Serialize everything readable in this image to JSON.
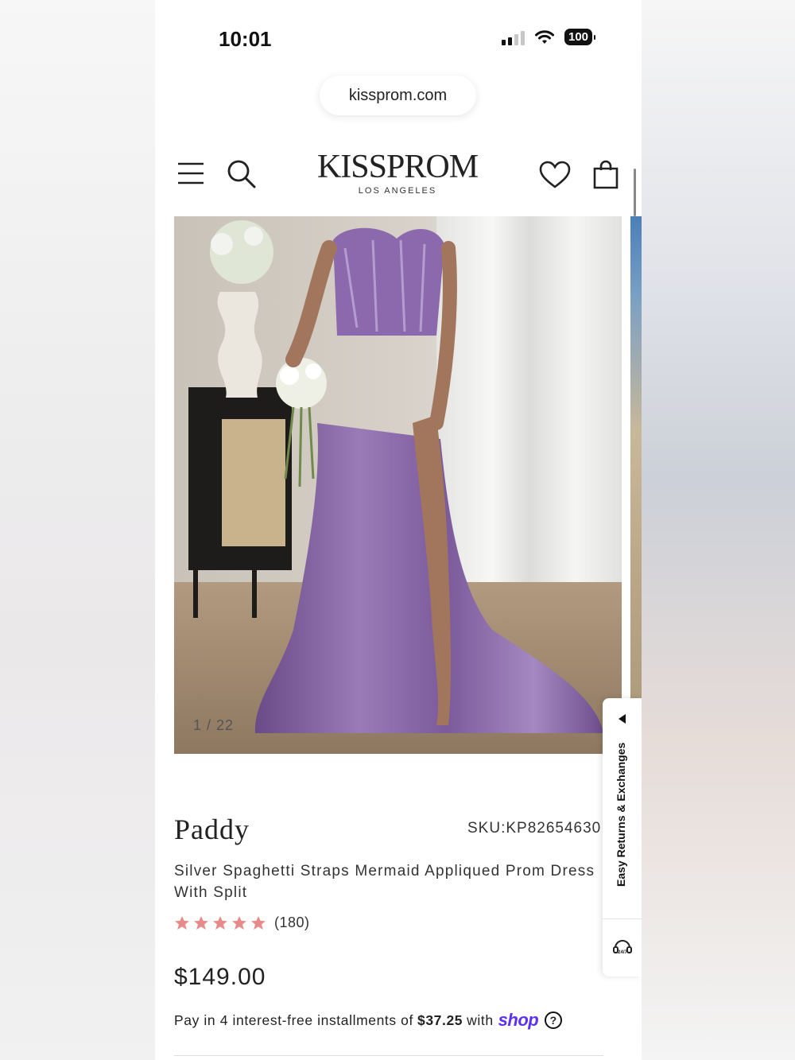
{
  "status_bar": {
    "time": "10:01",
    "battery": "100"
  },
  "browser": {
    "url": "kissprom.com"
  },
  "header": {
    "logo_main": "KISSPROM",
    "logo_sub": "LOS ANGELES",
    "icons": [
      "menu-icon",
      "search-icon",
      "heart-icon",
      "shopping-bag-icon"
    ]
  },
  "gallery": {
    "counter": "1 / 22"
  },
  "side_tab": {
    "label": "Easy Returns & Exchanges",
    "support_icon": "24-7-support-icon"
  },
  "product": {
    "name": "Paddy",
    "sku": "SKU:KP82654630",
    "description": "Silver Spaghetti Straps Mermaid Appliqued Prom Dress With Split",
    "rating": 5,
    "review_count": "(180)",
    "price": "$149.00",
    "installments_prefix": "Pay in 4 interest-free installments of",
    "installment_amount": "$37.25",
    "installments_with": "with",
    "shop_brand": "shop",
    "star_color": "#e98a8a",
    "shop_color": "#5a31f4"
  }
}
